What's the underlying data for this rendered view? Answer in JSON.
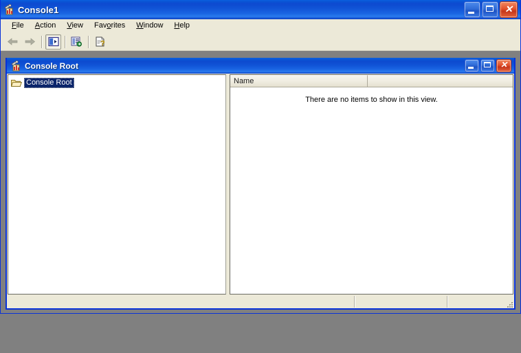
{
  "app": {
    "title": "Console1",
    "icon": "mmc-console-icon"
  },
  "window_buttons": {
    "minimize": "minimize-button",
    "maximize": "maximize-button",
    "close": "close-button",
    "minimize_glyph": "_",
    "maximize_glyph": "□",
    "close_glyph": "✕"
  },
  "menu": {
    "items": [
      {
        "label": "File",
        "accel": "F"
      },
      {
        "label": "Action",
        "accel": "A"
      },
      {
        "label": "View",
        "accel": "V"
      },
      {
        "label": "Favorites",
        "accel": "o"
      },
      {
        "label": "Window",
        "accel": "W"
      },
      {
        "label": "Help",
        "accel": "H"
      }
    ]
  },
  "toolbar": {
    "buttons": [
      {
        "name": "back-button",
        "icon": "left-arrow-icon",
        "enabled": false,
        "pressed": false
      },
      {
        "name": "forward-button",
        "icon": "right-arrow-icon",
        "enabled": false,
        "pressed": false
      },
      {
        "name": "show-hide-tree-button",
        "icon": "console-tree-icon",
        "enabled": true,
        "pressed": true
      },
      {
        "name": "export-list-button",
        "icon": "export-list-icon",
        "enabled": true,
        "pressed": false
      },
      {
        "name": "help-button",
        "icon": "help-question-icon",
        "enabled": true,
        "pressed": false
      }
    ]
  },
  "child_window": {
    "title": "Console Root",
    "icon": "mmc-console-icon"
  },
  "tree": {
    "nodes": [
      {
        "label": "Console Root",
        "icon": "open-folder-icon",
        "selected": true,
        "focused": true
      }
    ]
  },
  "list": {
    "columns": [
      {
        "label": "Name"
      },
      {
        "label": ""
      }
    ],
    "empty_message": "There are no items to show in this view.",
    "rows": []
  },
  "statusbar": {
    "panes": [
      "",
      "",
      ""
    ]
  },
  "colors": {
    "title_blue": "#0a54d5",
    "window_border": "#0831d9",
    "face": "#ece9d8",
    "desktop": "#808080",
    "selection": "#0a246a",
    "pane_white": "#ffffff"
  }
}
